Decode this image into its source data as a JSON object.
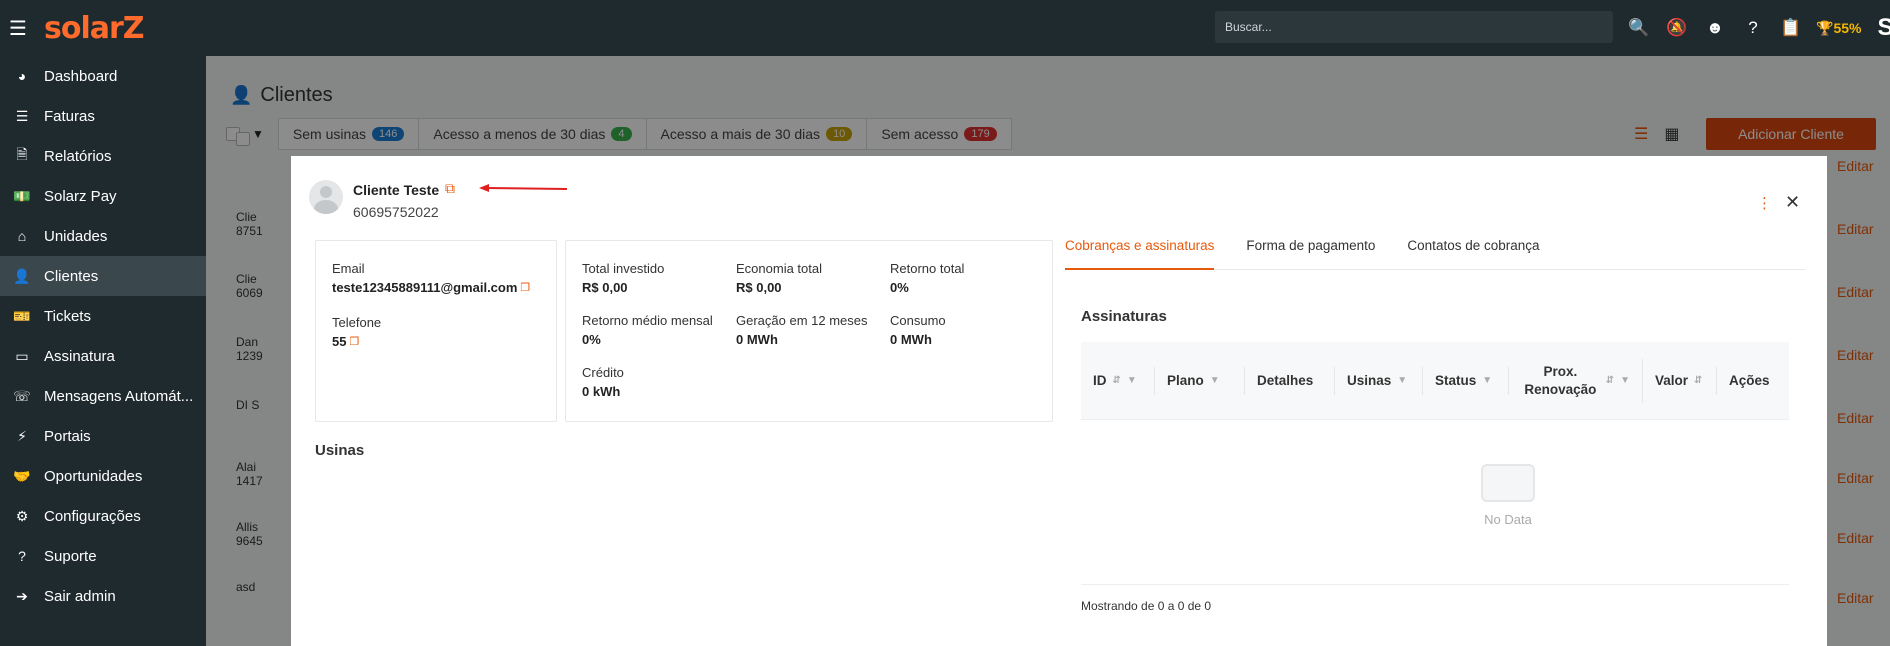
{
  "topbar": {
    "logo": "solarZ",
    "search_placeholder": "Buscar...",
    "progress_pct": "55%",
    "corner": "S"
  },
  "sidebar": {
    "items": [
      {
        "label": "Dashboard",
        "icon": "dashboard-icon"
      },
      {
        "label": "Faturas",
        "icon": "barcode-icon"
      },
      {
        "label": "Relatórios",
        "icon": "file-icon"
      },
      {
        "label": "Solarz Pay",
        "icon": "money-icon"
      },
      {
        "label": "Unidades",
        "icon": "home-icon"
      },
      {
        "label": "Clientes",
        "icon": "user-icon",
        "active": true
      },
      {
        "label": "Tickets",
        "icon": "ticket-icon"
      },
      {
        "label": "Assinatura",
        "icon": "card-icon"
      },
      {
        "label": "Mensagens Automát...",
        "icon": "whatsapp-icon"
      },
      {
        "label": "Portais",
        "icon": "plug-icon"
      },
      {
        "label": "Oportunidades",
        "icon": "handshake-icon"
      },
      {
        "label": "Configurações",
        "icon": "gear-icon"
      },
      {
        "label": "Suporte",
        "icon": "question-icon"
      },
      {
        "label": "Sair admin",
        "icon": "logout-icon"
      }
    ]
  },
  "page": {
    "title": "Clientes",
    "filters": [
      {
        "label": "Sem usinas",
        "count": "146",
        "color": "#1c7ed6"
      },
      {
        "label": "Acesso a menos de 30 dias",
        "count": "4",
        "color": "#37b24d"
      },
      {
        "label": "Acesso a mais de 30 dias",
        "count": "10",
        "color": "#c7a008"
      },
      {
        "label": "Sem acesso",
        "count": "179",
        "color": "#e03131"
      }
    ],
    "add_button": "Adicionar Cliente",
    "edit_label": "Editar",
    "bg_rows": [
      {
        "name": "",
        "sub": ""
      },
      {
        "name": "Clie",
        "sub": "8751"
      },
      {
        "name": "Clie",
        "sub": "6069"
      },
      {
        "name": "Dan",
        "sub": "1239"
      },
      {
        "name": "DI S",
        "sub": ""
      },
      {
        "name": "Alai",
        "sub": "1417"
      },
      {
        "name": "Allis",
        "sub": "9645"
      },
      {
        "name": "asd",
        "sub": ""
      }
    ]
  },
  "modal": {
    "client_name": "Cliente Teste",
    "client_doc": "60695752022",
    "contact": {
      "email_label": "Email",
      "email": "teste12345889111@gmail.com",
      "phone_label": "Telefone",
      "phone": "55"
    },
    "stats": [
      {
        "label": "Total investido",
        "value": "R$ 0,00"
      },
      {
        "label": "Economia total",
        "value": "R$ 0,00"
      },
      {
        "label": "Retorno total",
        "value": "0%"
      },
      {
        "label": "Retorno médio mensal",
        "value": "0%"
      },
      {
        "label": "Geração em 12 meses",
        "value": "0 MWh"
      },
      {
        "label": "Consumo",
        "value": "0 MWh"
      },
      {
        "label": "Crédito",
        "value": "0 kWh"
      }
    ],
    "usinas_title": "Usinas",
    "tabs": [
      "Cobranças e assinaturas",
      "Forma de pagamento",
      "Contatos de cobrança"
    ],
    "assinaturas_title": "Assinaturas",
    "columns": [
      "ID",
      "Plano",
      "Detalhes",
      "Usinas",
      "Status",
      "Prox. Renovação",
      "Valor",
      "Ações"
    ],
    "no_data": "No Data",
    "footer": "Mostrando de 0 a 0 de 0"
  }
}
